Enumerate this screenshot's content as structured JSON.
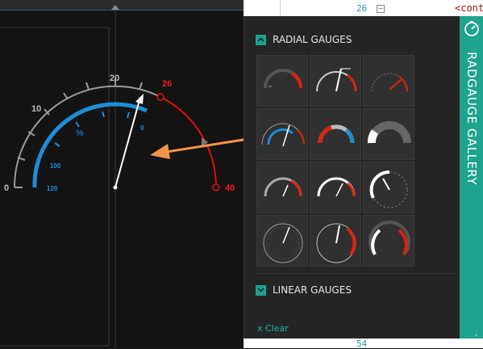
{
  "editor": {
    "line_top": "26",
    "line_bottom": "54",
    "code_snippet": "<cont"
  },
  "gauge": {
    "outer_ticks": [
      "0",
      "10",
      "20"
    ],
    "red_labels": [
      "26",
      "40"
    ],
    "inner_ticks": [
      "120",
      "100",
      "0"
    ],
    "unit": "%",
    "colors": {
      "outer_scale": "#9a9a9a",
      "red_range": "#dd1010",
      "inner_scale": "#1e8ed6",
      "needle": "#ffffff",
      "annotation_arrow": "#f0954a"
    }
  },
  "gallery": {
    "radial_title": "RADIAL GAUGES",
    "linear_title": "LINEAR GAUGES",
    "clear_label": "x Clear",
    "tab_label": "RADGAUGE GALLERY",
    "accent": "#1fa38d",
    "thumbnails": [
      {
        "id": 1,
        "style": "dark-arc-red"
      },
      {
        "id": 2,
        "style": "scale-needle"
      },
      {
        "id": 3,
        "style": "dotted-red"
      },
      {
        "id": 4,
        "style": "blue-inner"
      },
      {
        "id": 5,
        "style": "thick-red"
      },
      {
        "id": 6,
        "style": "solid-donut"
      },
      {
        "id": 7,
        "style": "arc-red-small"
      },
      {
        "id": 8,
        "style": "white-arc"
      },
      {
        "id": 9,
        "style": "ring-ticks"
      },
      {
        "id": 10,
        "style": "full-circle"
      },
      {
        "id": 11,
        "style": "full-circle-red"
      },
      {
        "id": 12,
        "style": "full-circle-white"
      }
    ]
  }
}
